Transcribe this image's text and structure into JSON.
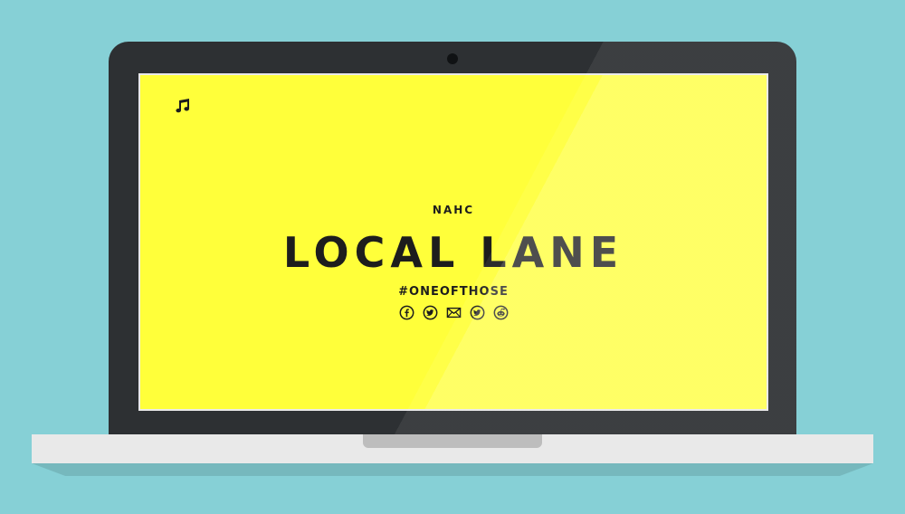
{
  "page": {
    "artist": "NAHC",
    "title": "LOCAL LANE",
    "hashtag": "#ONEOFTHOSE"
  },
  "icons": {
    "music": "music-note-icon",
    "socials": [
      "facebook-icon",
      "twitter-icon",
      "mail-icon",
      "twitter-icon",
      "reddit-icon"
    ]
  },
  "colors": {
    "background": "#86d0d6",
    "screen": "#ffff3a",
    "text": "#1d1d1d",
    "laptop_body": "#2d3033",
    "laptop_base": "#e9e9e9"
  }
}
